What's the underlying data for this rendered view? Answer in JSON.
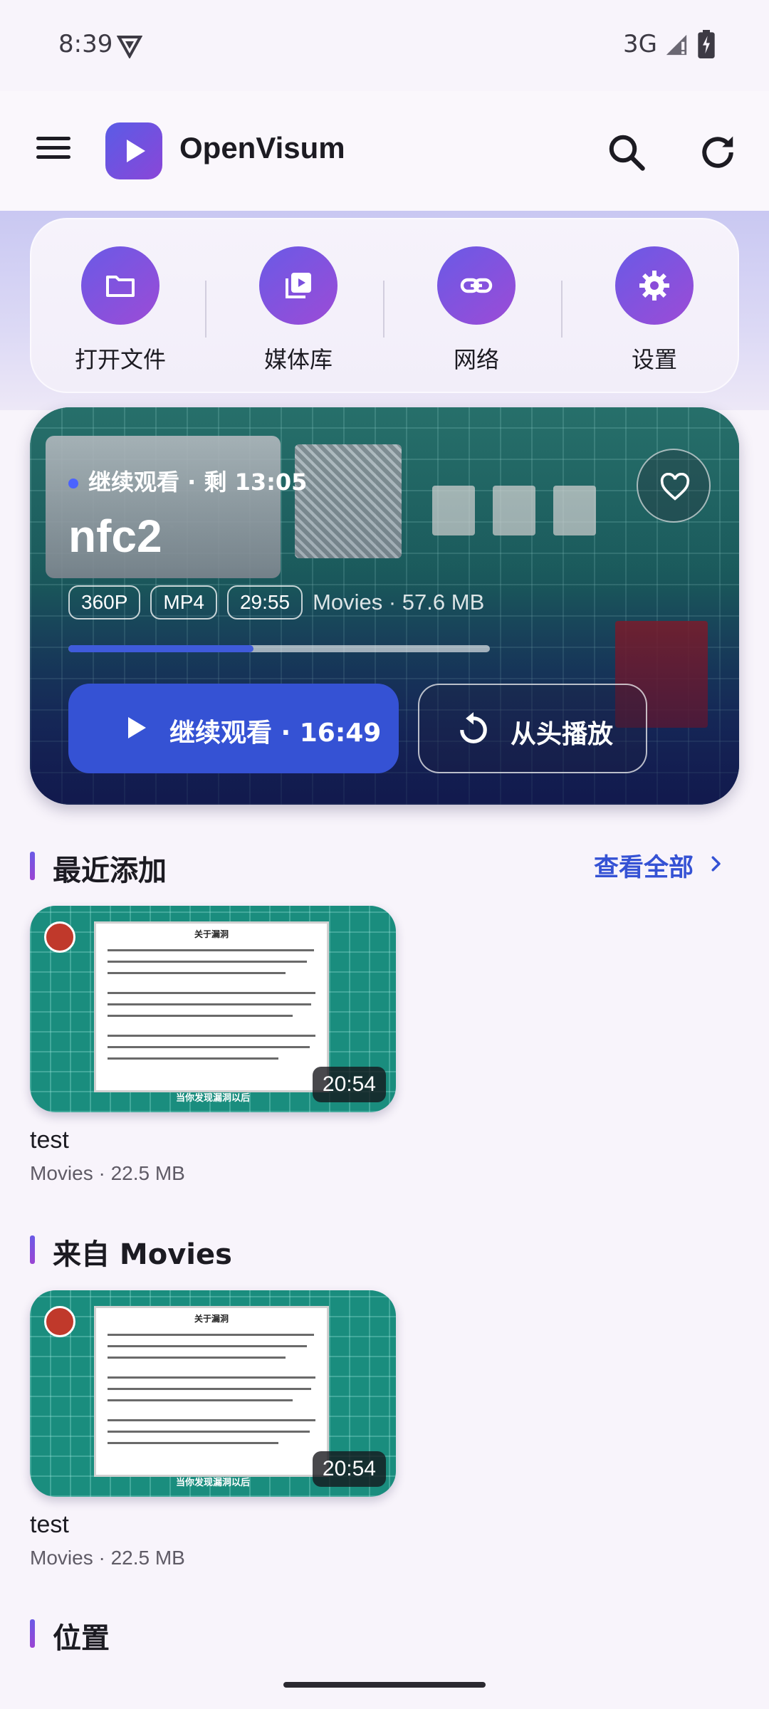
{
  "status_bar": {
    "time": "8:39",
    "network": "3G"
  },
  "app_bar": {
    "title": "OpenVisum"
  },
  "quick_actions": [
    {
      "label": "打开文件",
      "icon": "folder-icon"
    },
    {
      "label": "媒体库",
      "icon": "video-library-icon"
    },
    {
      "label": "网络",
      "icon": "link-icon"
    },
    {
      "label": "设置",
      "icon": "gear-icon"
    }
  ],
  "hero": {
    "subtitle": "继续观看 · 剩 13:05",
    "title": "nfc2",
    "chips": [
      "360P",
      "MP4",
      "29:55"
    ],
    "meta": "Movies · 57.6 MB",
    "progress_fraction": 0.44,
    "resume_label": "继续观看 · 16:49",
    "restart_label": "从头播放"
  },
  "sections": {
    "recent": {
      "title": "最近添加",
      "see_all": "查看全部"
    },
    "movies": {
      "title": "来自 Movies"
    },
    "locations": {
      "title": "位置"
    }
  },
  "recent_items": [
    {
      "name": "test",
      "sub": "Movies · 22.5 MB",
      "duration": "20:54",
      "thumb_title": "关于漏洞",
      "thumb_caption": "当你发现漏洞以后"
    }
  ],
  "movies_items": [
    {
      "name": "test",
      "sub": "Movies · 22.5 MB",
      "duration": "20:54",
      "thumb_title": "关于漏洞",
      "thumb_caption": "当你发现漏洞以后"
    }
  ],
  "colors": {
    "accent": "#3552d4",
    "brand_gradient_start": "#5a5ce6",
    "brand_gradient_end": "#9b44d3"
  }
}
